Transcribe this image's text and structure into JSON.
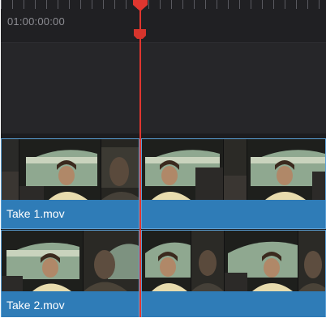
{
  "timeline": {
    "timecode": "01:00:00:00",
    "colors": {
      "playhead": "#e0362f",
      "clip": "#2f7cb7",
      "background": "#1f1f22"
    }
  },
  "tracks": [
    {
      "clip_label": "Take 1.mov",
      "thumbnail_icon": "video-thumbnail-icon"
    },
    {
      "clip_label": "Take 2.mov",
      "thumbnail_icon": "video-thumbnail-icon"
    }
  ]
}
